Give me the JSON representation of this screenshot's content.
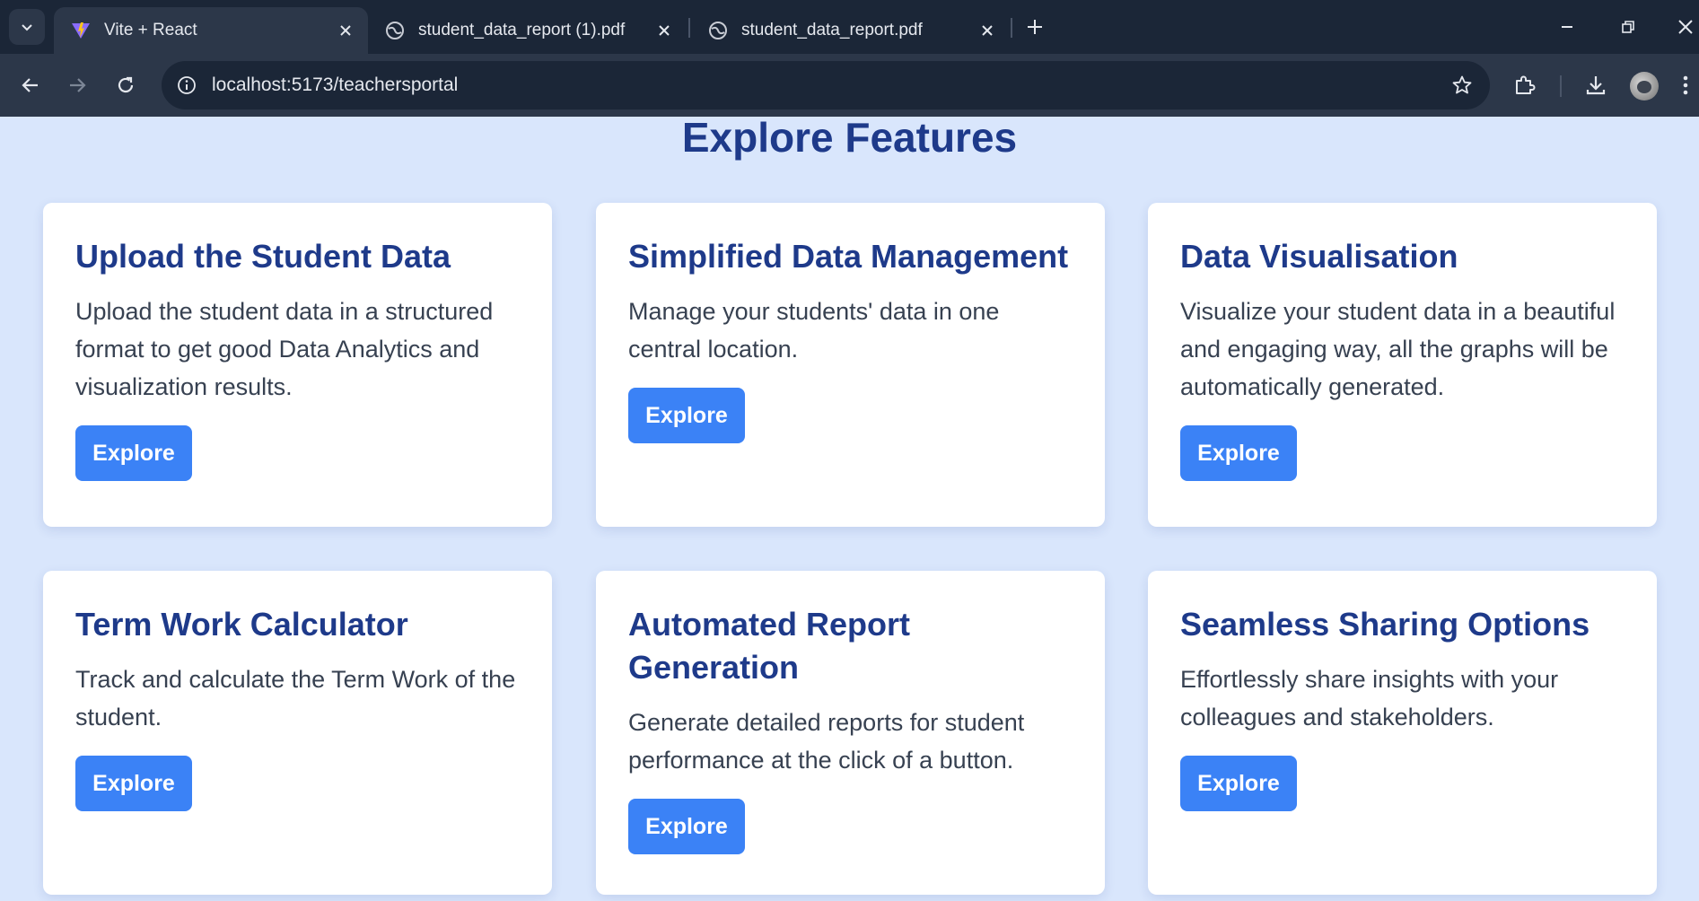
{
  "browser": {
    "tabs": [
      {
        "title": "Vite + React",
        "active": true,
        "favicon": "vite-logo-icon"
      },
      {
        "title": "student_data_report (1).pdf",
        "active": false,
        "favicon": "globe-icon"
      },
      {
        "title": "student_data_report.pdf",
        "active": false,
        "favicon": "globe-icon"
      }
    ],
    "url_host": "localhost",
    "url_path": ":5173/teachersportal"
  },
  "page": {
    "heading": "Explore Features",
    "cards": [
      {
        "title": "Upload the Student Data",
        "description": "Upload the student data in a structured format to get good Data Analytics and visualization results.",
        "button": "Explore"
      },
      {
        "title": "Simplified Data Management",
        "description": "Manage your students' data in one central location.",
        "button": "Explore"
      },
      {
        "title": "Data Visualisation",
        "description": "Visualize your student data in a beautiful and engaging way, all the graphs will be automatically generated.",
        "button": "Explore"
      },
      {
        "title": "Term Work Calculator",
        "description": "Track and calculate the Term Work of the student.",
        "button": "Explore"
      },
      {
        "title": "Automated Report Generation",
        "description": "Generate detailed reports for student performance at the click of a button.",
        "button": "Explore"
      },
      {
        "title": "Seamless Sharing Options",
        "description": "Effortlessly share insights with your colleagues and stakeholders.",
        "button": "Explore"
      }
    ]
  },
  "colors": {
    "page_background": "#d9e6fc",
    "heading": "#1e3a8a",
    "button": "#3b82f6",
    "card": "#ffffff"
  }
}
